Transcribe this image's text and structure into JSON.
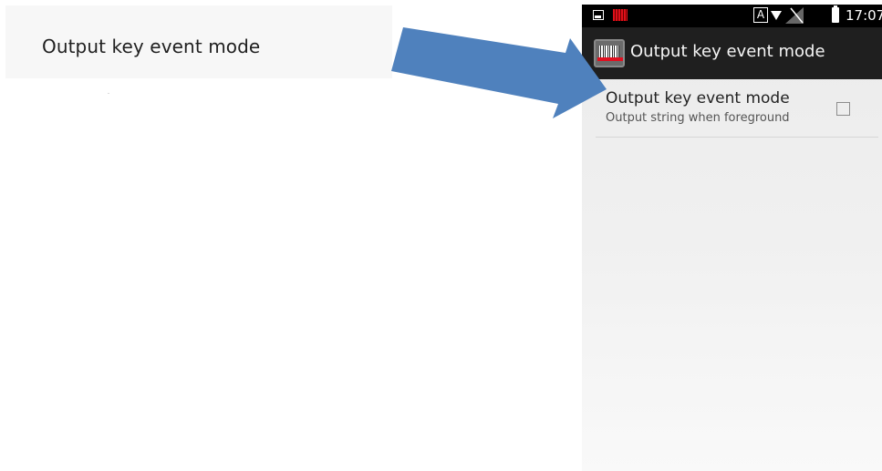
{
  "callout": {
    "label": "Output key event mode"
  },
  "arrow": {
    "color": "#4f81bd"
  },
  "phone": {
    "status_bar": {
      "time": "17:07",
      "a_label": "A",
      "icons": [
        "image-icon",
        "barcode-scanner-icon",
        "a-box-icon",
        "wifi-icon",
        "signal-icon",
        "battery-icon"
      ]
    },
    "action_bar": {
      "title": "Output key event mode",
      "icon": "barcode-scanner-icon"
    },
    "preference": {
      "title": "Output key event mode",
      "summary": "Output string when foreground",
      "checked": false
    }
  }
}
